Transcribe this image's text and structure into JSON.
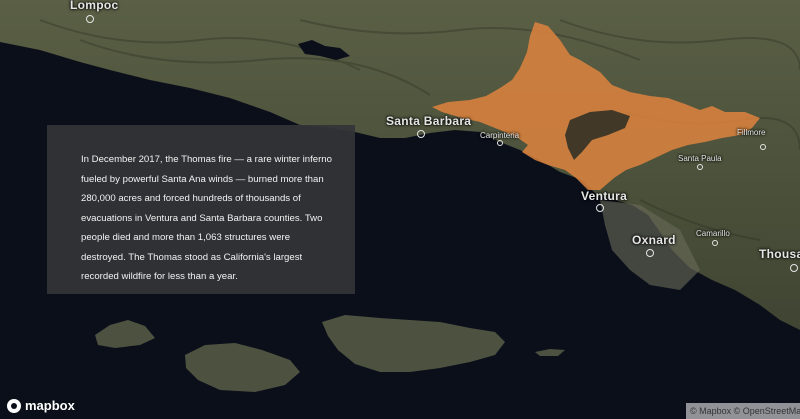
{
  "description_text": "In December 2017, the Thomas fire — a rare winter inferno fueled by powerful Santa Ana winds — burned more than 280,000 acres and forced hundreds of thousands of evacuations in Ventura and Santa Barbara counties. Two people died and more than 1,063 structures were destroyed. The Thomas stood as California's largest recorded wildfire for less than a year.",
  "cities": {
    "lompoc": "Lompoc",
    "santa_barbara": "Santa Barbara",
    "carpinteria": "Carpinteria",
    "fillmore": "Fillmore",
    "santa_paula": "Santa Paula",
    "ventura": "Ventura",
    "oxnard": "Oxnard",
    "camarillo": "Camarillo",
    "thousand_oaks": "Thousan"
  },
  "logo_text": "mapbox",
  "attribution": "© Mapbox © OpenStreetMap",
  "colors": {
    "ocean": "#0b0f1a",
    "land": "#4a4f3a",
    "fire": "#d9823e",
    "info_box": "#343438"
  }
}
